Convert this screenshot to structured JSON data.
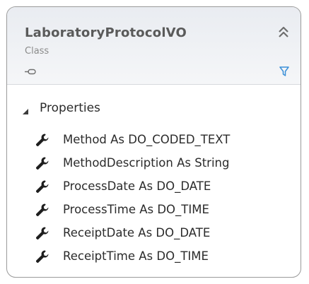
{
  "class_box": {
    "title": "LaboratoryProtocolVO",
    "kind": "Class",
    "icons": {
      "collapse": "double-chevron-up-icon",
      "toggle": "toggle-icon",
      "filter": "filter-icon"
    }
  },
  "properties": {
    "section_label": "Properties",
    "expanded": true,
    "item_icon": "wrench-icon",
    "items": [
      "Method As DO_CODED_TEXT",
      "MethodDescription As String",
      "ProcessDate As DO_DATE",
      "ProcessTime As DO_TIME",
      "ReceiptDate As DO_DATE",
      "ReceiptTime As DO_TIME"
    ]
  },
  "colors": {
    "header_bg": "#eef0f3",
    "border": "#9a9a9a",
    "filter_accent": "#3a8fd8"
  }
}
